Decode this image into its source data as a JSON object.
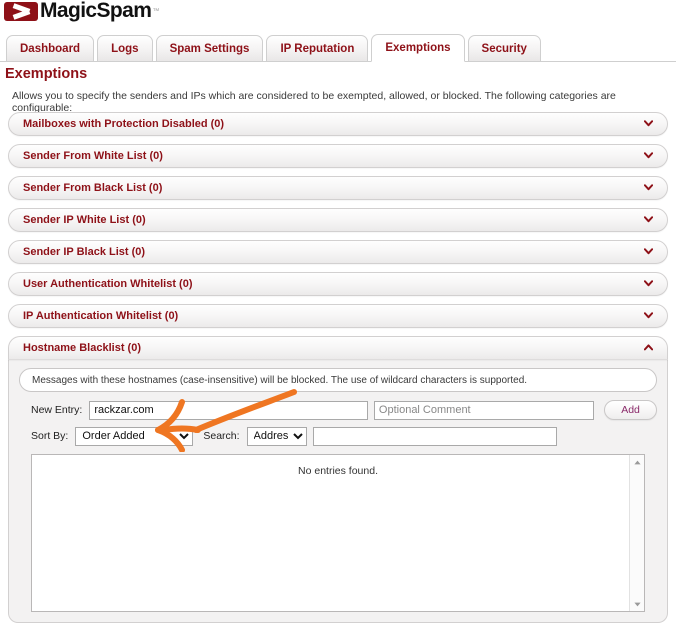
{
  "brand": {
    "name": "MagicSpam",
    "trademark": "™",
    "logo_icon": "magicspam-mask-logo",
    "logo_color": "#8e1118"
  },
  "tabs": [
    {
      "label": "Dashboard",
      "active": false
    },
    {
      "label": "Logs",
      "active": false
    },
    {
      "label": "Spam Settings",
      "active": false
    },
    {
      "label": "IP Reputation",
      "active": false
    },
    {
      "label": "Exemptions",
      "active": true
    },
    {
      "label": "Security",
      "active": false
    }
  ],
  "page": {
    "title": "Exemptions",
    "description": "Allows you to specify the senders and IPs which are considered to be exempted, allowed, or blocked. The following categories are configurable:"
  },
  "accordion": {
    "sections": [
      {
        "label": "Mailboxes with Protection Disabled (0)",
        "count": 0,
        "expanded": false,
        "icon": "chevron-down-icon"
      },
      {
        "label": "Sender From White List (0)",
        "count": 0,
        "expanded": false,
        "icon": "chevron-down-icon"
      },
      {
        "label": "Sender From Black List (0)",
        "count": 0,
        "expanded": false,
        "icon": "chevron-down-icon"
      },
      {
        "label": "Sender IP White List (0)",
        "count": 0,
        "expanded": false,
        "icon": "chevron-down-icon"
      },
      {
        "label": "Sender IP Black List (0)",
        "count": 0,
        "expanded": false,
        "icon": "chevron-down-icon"
      },
      {
        "label": "User Authentication Whitelist (0)",
        "count": 0,
        "expanded": false,
        "icon": "chevron-down-icon"
      },
      {
        "label": "IP Authentication Whitelist (0)",
        "count": 0,
        "expanded": false,
        "icon": "chevron-down-icon"
      },
      {
        "label": "Hostname Blacklist (0)",
        "count": 0,
        "expanded": true,
        "icon": "chevron-up-icon"
      }
    ]
  },
  "hostname_blacklist_panel": {
    "info_text": "Messages with these hostnames (case-insensitive) will be blocked. The use of wildcard characters is supported.",
    "new_entry_label": "New Entry:",
    "new_entry_value": "rackzar.com",
    "comment_placeholder": "Optional Comment",
    "comment_value": "",
    "add_label": "Add",
    "sort_by_label": "Sort By:",
    "sort_by_value": "Order Added",
    "sort_by_options": [
      "Order Added"
    ],
    "search_label": "Search:",
    "search_field_value": "Address",
    "search_field_options": [
      "Address"
    ],
    "search_value": "",
    "search_placeholder": "",
    "empty_message": "No entries found.",
    "scroll_up_icon": "scroll-up-arrow-icon",
    "scroll_down_icon": "scroll-down-arrow-icon"
  },
  "annotation": {
    "type": "hand-drawn-arrow",
    "color": "#ef7622",
    "points_at": "new_entry_value"
  },
  "colors": {
    "brand_red": "#8e1118",
    "tab_text": "#8e1118",
    "annotation_orange": "#ef7622",
    "panel_bg": "#f3f2f2"
  }
}
